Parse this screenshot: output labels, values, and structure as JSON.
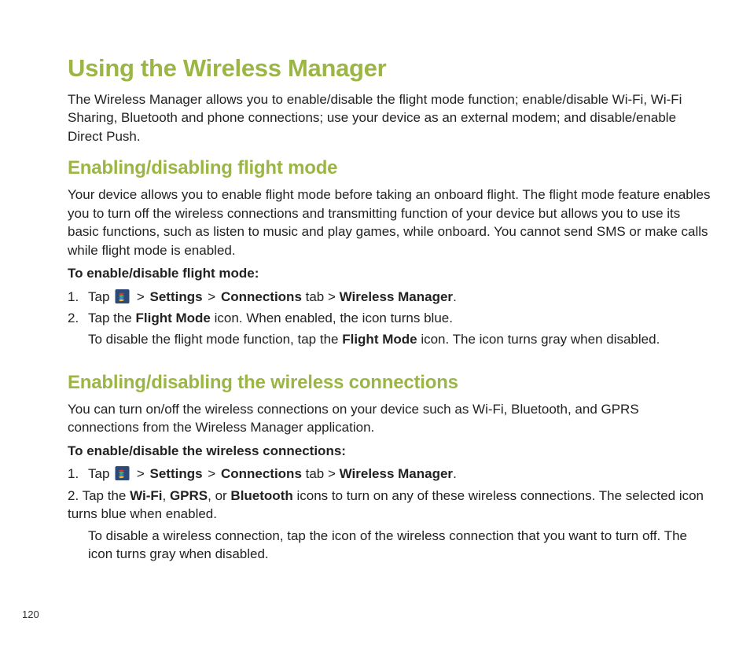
{
  "title": "Using the Wireless Manager",
  "intro": "The Wireless Manager allows you to enable/disable the flight mode function; enable/disable Wi-Fi, Wi-Fi Sharing, Bluetooth and phone connections; use your device as an external modem; and disable/enable Direct Push.",
  "s1": {
    "heading": "Enabling/disabling flight mode",
    "para": "Your device allows you to enable flight mode before taking an onboard flight. The flight mode feature enables you to turn off the wireless connections and transmitting function of your device but allows you to use its basic functions, such as listen to music and play games, while onboard. You cannot send SMS or make calls while flight mode is enabled.",
    "label": "To enable/disable flight mode:",
    "step1": {
      "num": "1.",
      "pre": "Tap ",
      "settings": "Settings",
      "connections": "Connections",
      "tab": " tab > ",
      "wm": "Wireless Manager",
      "end": "."
    },
    "step2": {
      "num": "2.",
      "pre": "Tap the ",
      "b": "Flight Mode",
      "post": " icon. When enabled, the icon turns blue."
    },
    "step2b": {
      "pre": "To disable the flight mode function, tap the ",
      "b": "Flight Mode",
      "post": " icon. The icon turns gray when disabled."
    }
  },
  "s2": {
    "heading": "Enabling/disabling the wireless connections",
    "para": "You can turn on/off the wireless connections on your device such as Wi-Fi, Bluetooth, and GPRS connections from the Wireless Manager application.",
    "label": "To enable/disable the wireless connections:",
    "step1": {
      "num": "1.",
      "pre": "Tap ",
      "settings": "Settings",
      "connections": "Connections",
      "tab": " tab > ",
      "wm": "Wireless Manager",
      "end": "."
    },
    "step2": {
      "num": "2. Tap the ",
      "b1": "Wi-Fi",
      "c1": ", ",
      "b2": "GPRS",
      "c2": ", or ",
      "b3": "Bluetooth",
      "post": " icons to turn on any of these wireless connections. The selected icon turns blue when enabled."
    },
    "step2b": "To disable a wireless connection, tap the icon of the wireless connection that you want to turn off. The icon turns gray when disabled."
  },
  "gt": " > ",
  "page": "120"
}
